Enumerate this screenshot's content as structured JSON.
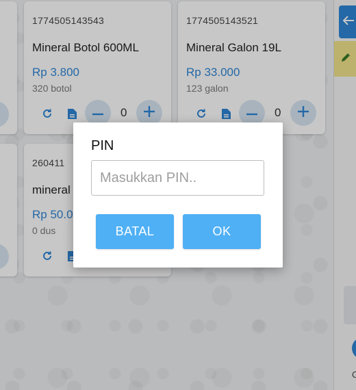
{
  "products": [
    {
      "code": "1774505143543",
      "name": "Mineral Botol 600ML",
      "price": "Rp 3.800",
      "stock": "320 botol",
      "qty": "0"
    },
    {
      "code": "1774505143521",
      "name": "Mineral Galon 19L",
      "price": "Rp 33.000",
      "stock": "123 galon",
      "qty": "0"
    },
    {
      "code": "260411",
      "name": "mineral",
      "price": "Rp 50.0",
      "stock": "0 dus"
    }
  ],
  "side_label": "C",
  "dialog": {
    "title": "PIN",
    "pin_placeholder": "Masukkan PIN..",
    "pin_value": "",
    "cancel_label": "BATAL",
    "ok_label": "OK"
  },
  "colors": {
    "accent": "#4fb0f5",
    "price": "#2f86d6",
    "control_bg": "#d8e6f3",
    "edit_panel": "#f2e58c"
  },
  "icons": [
    "refresh-icon",
    "document-icon",
    "minus-icon",
    "plus-icon",
    "pencil-icon",
    "arrow-left-icon"
  ]
}
